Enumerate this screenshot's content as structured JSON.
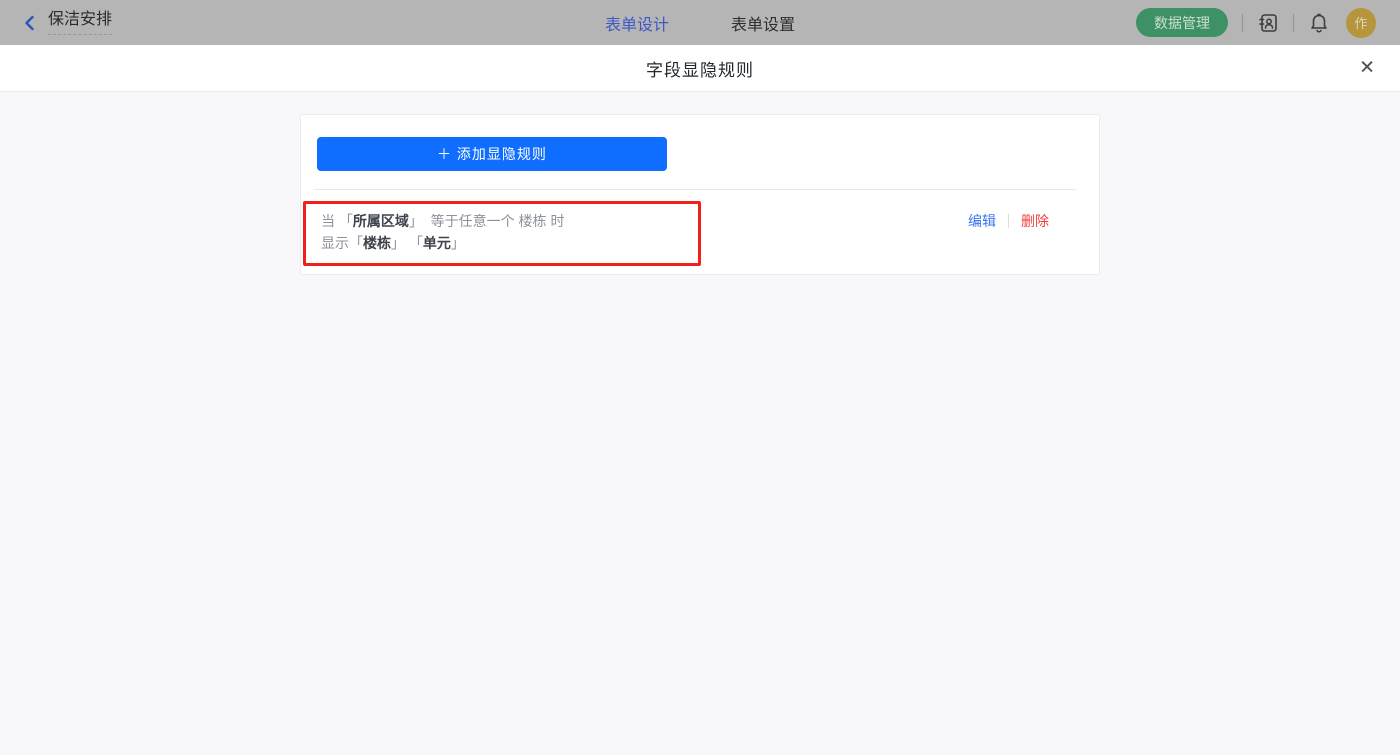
{
  "topbar": {
    "back_label": "保洁安排",
    "tabs": [
      {
        "label": "表单设计",
        "active": true
      },
      {
        "label": "表单设置",
        "active": false
      }
    ],
    "data_manage_label": "数据管理",
    "avatar_text": "作"
  },
  "modal": {
    "title": "字段显隐规则",
    "close_glyph": "✕"
  },
  "panel": {
    "add_button_label": "＋ 添加显隐规则",
    "rule": {
      "bracket_open": "「",
      "bracket_close": "」",
      "line1_prefix": "当",
      "line1_field": "所属区域",
      "line1_condition": "等于任意一个 楼栋 时",
      "line2_prefix": "显示",
      "line2_field1": "楼栋",
      "line2_field2": "单元"
    },
    "edit_label": "编辑",
    "delete_label": "删除"
  },
  "colors": {
    "accent_blue": "#0f6eff",
    "link_blue": "#3a74f6",
    "danger_red": "#f1403c",
    "annotation_red": "#f2201c",
    "brand_green": "#3e9066",
    "avatar_gold": "#b7953d"
  }
}
